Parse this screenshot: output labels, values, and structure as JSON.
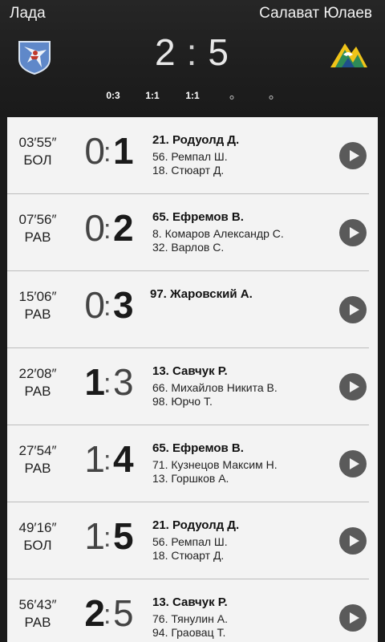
{
  "match": {
    "home_team": "Лада",
    "away_team": "Салават Юлаев",
    "home_score": "2",
    "away_score": "5",
    "separator": ":",
    "periods": [
      "0:3",
      "1:1",
      "1:1"
    ],
    "period_placeholders": 2
  },
  "goals": [
    {
      "time": "03′55″",
      "type": "БОЛ",
      "home": "0",
      "away": "1",
      "scoring_side": "away",
      "scorer": "21. Родуолд Д.",
      "assists": [
        "56. Ремпал Ш.",
        "18. Стюарт Д."
      ]
    },
    {
      "time": "07′56″",
      "type": "РАВ",
      "home": "0",
      "away": "2",
      "scoring_side": "away",
      "scorer": "65. Ефремов В.",
      "assists": [
        "8. Комаров Александр С.",
        "32. Варлов С."
      ]
    },
    {
      "time": "15′06″",
      "type": "РАВ",
      "home": "0",
      "away": "3",
      "scoring_side": "away",
      "scorer": "97. Жаровский А.",
      "assists": []
    },
    {
      "time": "22′08″",
      "type": "РАВ",
      "home": "1",
      "away": "3",
      "scoring_side": "home",
      "scorer": "13. Савчук Р.",
      "assists": [
        "66. Михайлов Никита В.",
        "98. Юрчо Т."
      ]
    },
    {
      "time": "27′54″",
      "type": "РАВ",
      "home": "1",
      "away": "4",
      "scoring_side": "away",
      "scorer": "65. Ефремов В.",
      "assists": [
        "71. Кузнецов Максим Н.",
        "13. Горшков А."
      ]
    },
    {
      "time": "49′16″",
      "type": "БОЛ",
      "home": "1",
      "away": "5",
      "scoring_side": "away",
      "scorer": "21. Родуолд Д.",
      "assists": [
        "56. Ремпал Ш.",
        "18. Стюарт Д."
      ]
    },
    {
      "time": "56′43″",
      "type": "РАВ",
      "home": "2",
      "away": "5",
      "scoring_side": "home",
      "scorer": "13. Савчук Р.",
      "assists": [
        "76. Тянулин А.",
        "94. Граовац Т."
      ]
    }
  ],
  "icons": {
    "play": "play-icon",
    "home_logo": "lada-logo",
    "away_logo": "salavat-yulaev-logo"
  },
  "colors": {
    "header_bg": "#1e1e1e",
    "panel_bg": "#f3f3f3",
    "play_button": "#5a5a5a"
  }
}
